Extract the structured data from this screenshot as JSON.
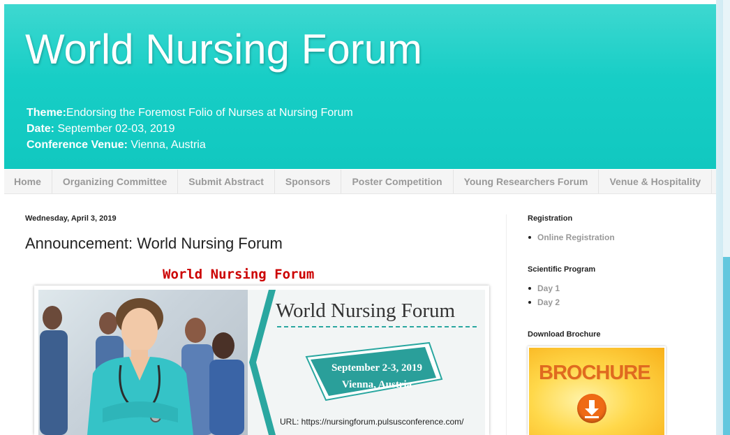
{
  "header": {
    "title": "World Nursing Forum",
    "theme_label": "Theme:",
    "theme_value": "Endorsing the Foremost Folio of Nurses at Nursing Forum",
    "date_label": "Date:",
    "date_value": " September 02-03, 2019",
    "venue_label": "Conference Venue:",
    "venue_value": " Vienna, Austria"
  },
  "nav": {
    "items": [
      {
        "label": "Home"
      },
      {
        "label": "Organizing Committee"
      },
      {
        "label": "Submit Abstract"
      },
      {
        "label": "Sponsors"
      },
      {
        "label": "Poster Competition"
      },
      {
        "label": "Young Researchers Forum"
      },
      {
        "label": "Venue & Hospitality"
      }
    ]
  },
  "post": {
    "date": "Wednesday, April 3, 2019",
    "title": "Announcement: World Nursing Forum",
    "banner_caption": "World Nursing Forum",
    "banner": {
      "heading": "World Nursing Forum",
      "dates": "September 2-3, 2019",
      "location": "Vienna, Austria",
      "url": "URL: https://nursingforum.pulsusconference.com/"
    }
  },
  "sidebar": {
    "registration": {
      "title": "Registration",
      "items": [
        {
          "label": "Online Registration"
        }
      ]
    },
    "scientific_program": {
      "title": "Scientific Program",
      "items": [
        {
          "label": "Day 1"
        },
        {
          "label": "Day 2"
        }
      ]
    },
    "brochure": {
      "title": "Download Brochure",
      "image_label": "BROCHURE"
    }
  },
  "colors": {
    "header_teal": "#17cec6",
    "accent_teal": "#2aa7a0",
    "caption_red": "#cc0000",
    "brochure_orange": "#e06a1f"
  }
}
